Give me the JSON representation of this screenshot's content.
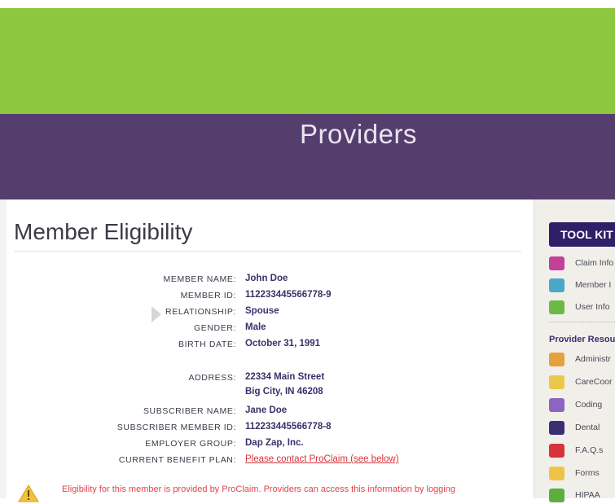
{
  "banner": {
    "title": "Providers"
  },
  "page": {
    "title": "Member Eligibility"
  },
  "member": [
    {
      "label": "MEMBER NAME:",
      "value": "John Doe"
    },
    {
      "label": "MEMBER ID:",
      "value": "112233445566778-9"
    },
    {
      "label": "RELATIONSHIP:",
      "value": "Spouse"
    },
    {
      "label": "GENDER:",
      "value": "Male"
    },
    {
      "label": "BIRTH DATE:",
      "value": "October 31, 1991"
    },
    {
      "label": "ADDRESS:",
      "value": "22334 Main Street",
      "value2": "Big City, IN 46208"
    },
    {
      "label": "SUBSCRIBER NAME:",
      "value": "Jane Doe"
    },
    {
      "label": "SUBSCRIBER MEMBER ID:",
      "value": "112233445566778-8"
    },
    {
      "label": "EMPLOYER GROUP:",
      "value": "Dap Zap, Inc."
    },
    {
      "label": "CURRENT BENEFIT PLAN:",
      "value": "Please contact ProClaim (see below)"
    }
  ],
  "notice": {
    "text": "Eligibility for this member is provided by ProClaim. Providers can access this information by logging"
  },
  "sidebar": {
    "toolkit_label": "TOOL KIT",
    "section_heading": "Provider Resou",
    "items": [
      {
        "label": "Claim Info",
        "icon": "claim-icon",
        "color": "#c2409a"
      },
      {
        "label": "Member I",
        "icon": "member-icon",
        "color": "#4ba6c8"
      },
      {
        "label": "User Info",
        "icon": "user-icon",
        "color": "#6cba45"
      }
    ],
    "resources": [
      {
        "label": "Administr",
        "icon": "admin-icon",
        "color": "#e6a03c"
      },
      {
        "label": "CareCoor",
        "icon": "care-icon",
        "color": "#e9c84a"
      },
      {
        "label": "Coding",
        "icon": "coding-icon",
        "color": "#8a66c2"
      },
      {
        "label": "Dental",
        "icon": "dental-icon",
        "color": "#3b2f73"
      },
      {
        "label": "F.A.Q.s",
        "icon": "faq-icon",
        "color": "#d8323a"
      },
      {
        "label": "Forms",
        "icon": "forms-icon",
        "color": "#ecc548"
      },
      {
        "label": "HIPAA",
        "icon": "hipaa-icon",
        "color": "#5cae3f"
      }
    ]
  }
}
